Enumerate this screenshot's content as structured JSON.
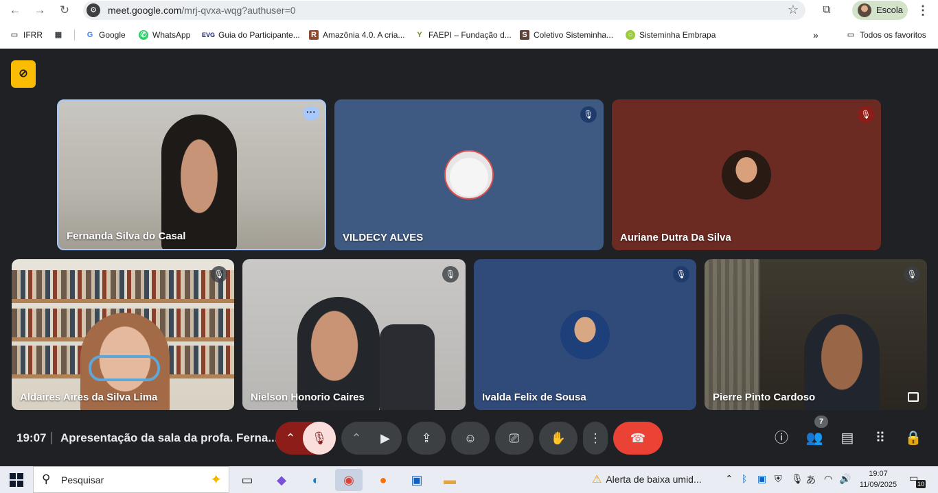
{
  "browser": {
    "url_host": "meet.google.com",
    "url_path": "/mrj-qvxa-wqg?authuser=0",
    "profile_label": "Escola"
  },
  "bookmarks": [
    {
      "label": "IFRR",
      "icon": "folder-icon"
    },
    {
      "label": "Google",
      "icon": "google-icon"
    },
    {
      "label": "WhatsApp",
      "icon": "whatsapp-icon"
    },
    {
      "label": "Guia do Participante...",
      "icon": "ev-icon"
    },
    {
      "label": "Amazônia 4.0. A cria...",
      "icon": "r-icon"
    },
    {
      "label": "FAEPI – Fundação d...",
      "icon": "leaf-icon"
    },
    {
      "label": "Coletivo Sisteminha...",
      "icon": "s-icon"
    },
    {
      "label": "Sisteminha Embrapa",
      "icon": "circle-icon"
    }
  ],
  "bookmarks_all": "Todos os favoritos",
  "tiles": [
    {
      "name": "Fernanda Silva do Casal"
    },
    {
      "name": "VILDECY ALVES"
    },
    {
      "name": "Auriane Dutra Da Silva"
    },
    {
      "name": "Aldaires Aires da Silva Lima"
    },
    {
      "name": "Nielson Honorio Caires"
    },
    {
      "name": "Ivalda Felix de Sousa"
    },
    {
      "name": "Pierre Pinto Cardoso"
    }
  ],
  "controls": {
    "time": "19:07",
    "meeting_title": "Apresentação da sala da profa. Ferna...",
    "people_count": "7"
  },
  "taskbar": {
    "search_placeholder": "Pesquisar",
    "alert_text": "Alerta de baixa umid...",
    "time": "19:07",
    "date": "11/09/2025",
    "notification_count": "10"
  },
  "colors": {
    "meet_bg": "#202124",
    "leave_red": "#ea4335",
    "active_border": "#a8c7fa",
    "badge_yellow": "#fbbc04"
  }
}
